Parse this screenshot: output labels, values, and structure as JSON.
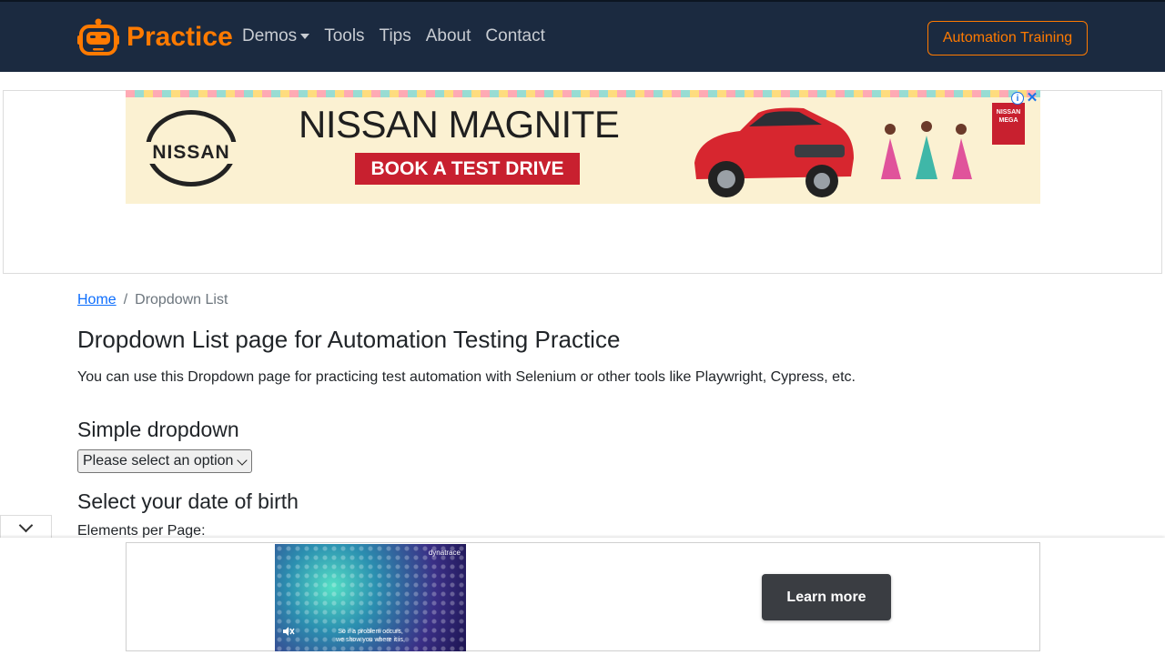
{
  "navbar": {
    "brand": "Practice",
    "links": [
      {
        "label": "Demos",
        "dropdown": true
      },
      {
        "label": "Tools"
      },
      {
        "label": "Tips"
      },
      {
        "label": "About"
      },
      {
        "label": "Contact"
      }
    ],
    "cta": "Automation Training"
  },
  "top_ad": {
    "brand": "NISSAN",
    "headline": "NISSAN MAGNITE",
    "cta": "BOOK A TEST DRIVE",
    "badge": "NISSAN MEGA",
    "info": "i",
    "close": "✕"
  },
  "breadcrumb": {
    "home": "Home",
    "separator": "/",
    "current": "Dropdown List"
  },
  "main": {
    "title": "Dropdown List page for Automation Testing Practice",
    "intro": "You can use this Dropdown page for practicing test automation with Selenium or other tools like Playwright, Cypress, etc.",
    "simple_heading": "Simple dropdown",
    "simple_select_value": "Please select an option",
    "dob_heading": "Select your date of birth",
    "per_page_label": "Elements per Page:"
  },
  "bottom_ad": {
    "video_brand": "dynatrace",
    "video_caption_1": "So if a problem occurs,",
    "video_caption_2": "we show you where it is,",
    "cta": "Learn more"
  },
  "colors": {
    "navbar_bg": "#1b2a40",
    "accent": "#ff7a00",
    "link": "#0d6efd"
  }
}
